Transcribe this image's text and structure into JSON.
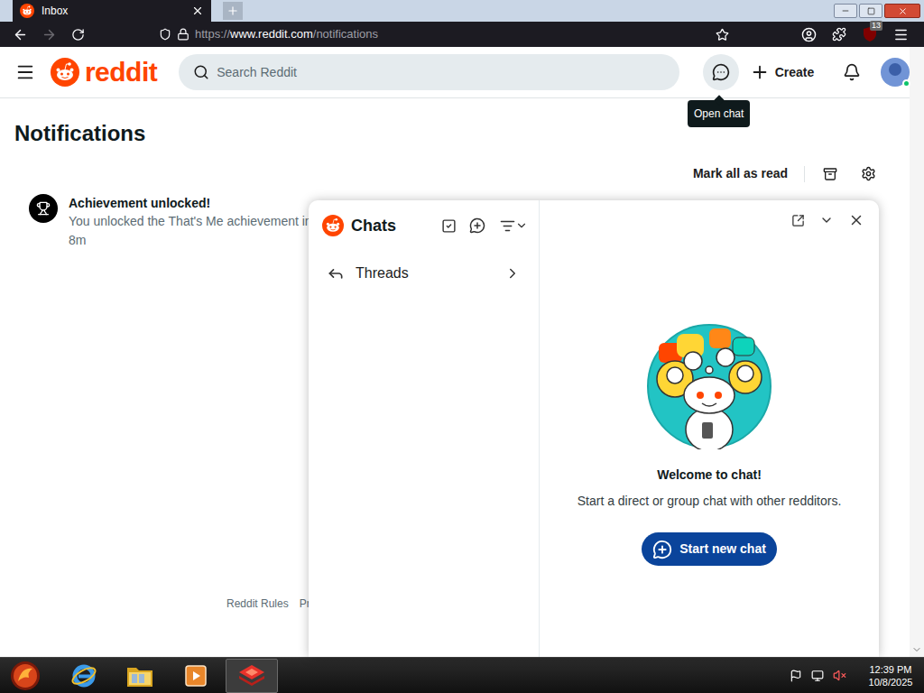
{
  "browser": {
    "tab": {
      "title": "Inbox"
    },
    "nav": {
      "back_disabled": false,
      "forward_disabled": true
    },
    "url": {
      "scheme": "https://",
      "host": "www.reddit.com",
      "path": "/notifications"
    },
    "extension_badge": "13"
  },
  "header": {
    "logo": "reddit",
    "search_placeholder": "Search Reddit",
    "chat_hovered": true,
    "create": "Create",
    "avatar_online": true,
    "tooltip": "Open chat"
  },
  "notifications": {
    "title": "Notifications",
    "mark_all": "Mark all as read",
    "items": [
      {
        "title": "Achievement unlocked!",
        "body": "You unlocked the That's Me achievement in",
        "time": "8m"
      }
    ],
    "footer_links": [
      "Reddit Rules",
      "Priv"
    ]
  },
  "chat": {
    "title": "Chats",
    "threads": "Threads",
    "welcome_title": "Welcome to chat!",
    "welcome_text": "Start a direct or group chat with other redditors.",
    "start_button": "Start new chat"
  },
  "taskbar": {
    "apps": [
      {
        "kind": "ie",
        "active": false
      },
      {
        "kind": "explorer",
        "active": false
      },
      {
        "kind": "media",
        "active": false
      },
      {
        "kind": "recorder",
        "active": true
      }
    ],
    "volume_muted": true,
    "time": "12:39 PM",
    "date": "10/8/2025"
  }
}
